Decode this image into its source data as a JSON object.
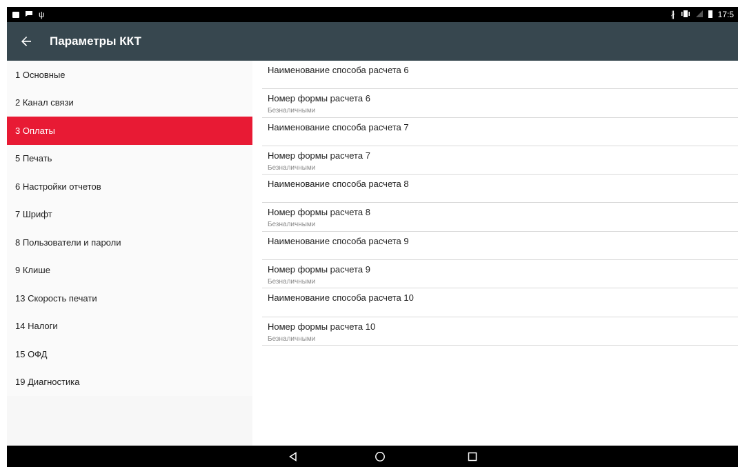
{
  "status_bar": {
    "time": "17:5",
    "left_icons": [
      "image-icon",
      "chat-icon",
      "usb-icon"
    ],
    "right_icons": [
      "bluetooth-icon",
      "vibrate-icon",
      "no-signal-icon",
      "battery-icon"
    ]
  },
  "app_bar": {
    "title": "Параметры ККТ",
    "back_icon": "arrow-back-icon"
  },
  "sidebar": {
    "items": [
      {
        "label": "1 Основные",
        "active": false
      },
      {
        "label": "2 Канал связи",
        "active": false
      },
      {
        "label": "3 Оплаты",
        "active": true
      },
      {
        "label": "5 Печать",
        "active": false
      },
      {
        "label": "6 Настройки отчетов",
        "active": false
      },
      {
        "label": "7 Шрифт",
        "active": false
      },
      {
        "label": "8 Пользователи и пароли",
        "active": false
      },
      {
        "label": "9 Клише",
        "active": false
      },
      {
        "label": "13 Скорость печати",
        "active": false
      },
      {
        "label": "14 Налоги",
        "active": false
      },
      {
        "label": "15 ОФД",
        "active": false
      },
      {
        "label": "19 Диагностика",
        "active": false
      }
    ]
  },
  "content": {
    "rows": [
      {
        "title": "Наименование способа расчета 6",
        "subtitle": ""
      },
      {
        "title": "Номер формы расчета 6",
        "subtitle": "Безналичными"
      },
      {
        "title": "Наименование способа расчета 7",
        "subtitle": ""
      },
      {
        "title": "Номер формы расчета 7",
        "subtitle": "Безналичными"
      },
      {
        "title": "Наименование способа расчета 8",
        "subtitle": ""
      },
      {
        "title": "Номер формы расчета 8",
        "subtitle": "Безналичными"
      },
      {
        "title": "Наименование способа расчета 9",
        "subtitle": ""
      },
      {
        "title": "Номер формы расчета 9",
        "subtitle": "Безналичными"
      },
      {
        "title": "Наименование способа расчета 10",
        "subtitle": ""
      },
      {
        "title": "Номер формы расчета 10",
        "subtitle": "Безналичными"
      }
    ]
  },
  "nav_bar": {
    "buttons": [
      "back-triangle-icon",
      "home-circle-icon",
      "recents-square-icon"
    ]
  },
  "colors": {
    "app_bar": "#37474f",
    "active_item": "#e81a34",
    "status_bar": "#000000"
  }
}
